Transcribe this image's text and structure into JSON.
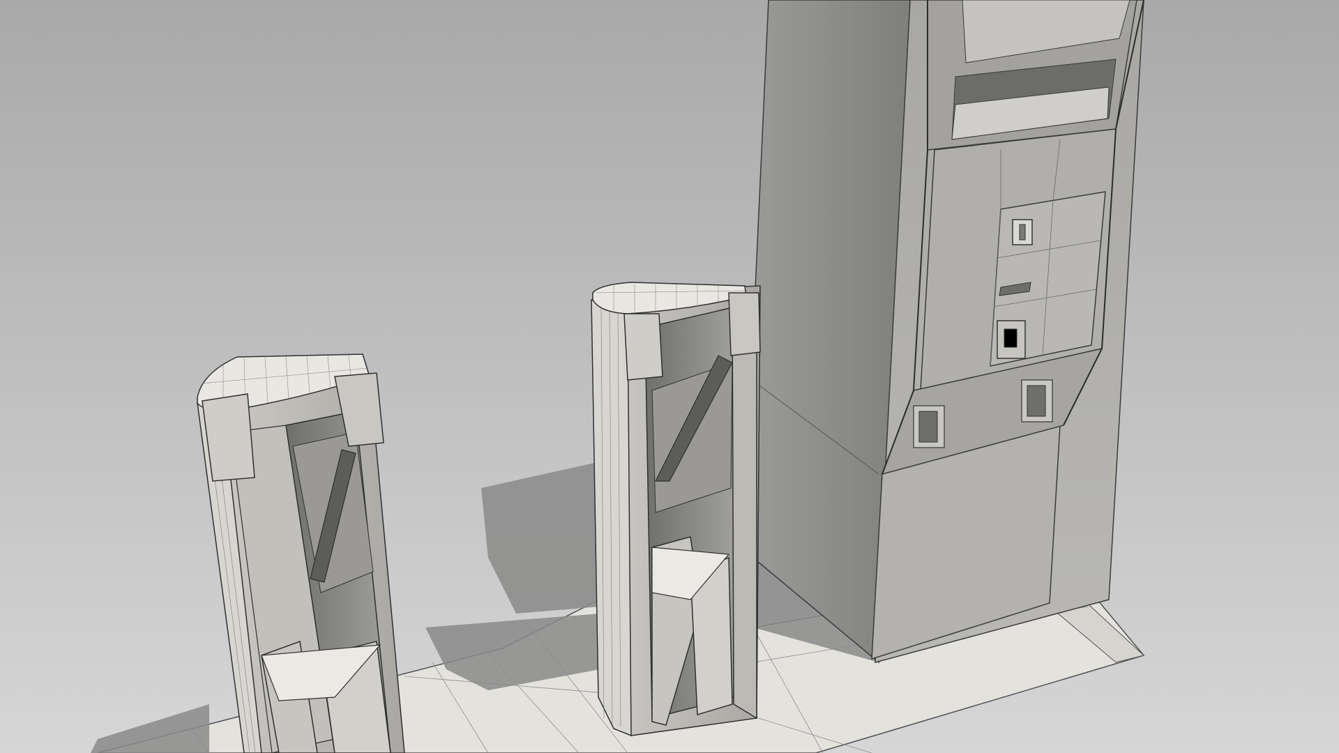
{
  "scene": {
    "objects": [
      {
        "name": "left-gate-pillar"
      },
      {
        "name": "center-gate-pillar"
      },
      {
        "name": "ticket-machine-tower"
      },
      {
        "name": "floor-slab"
      }
    ]
  }
}
